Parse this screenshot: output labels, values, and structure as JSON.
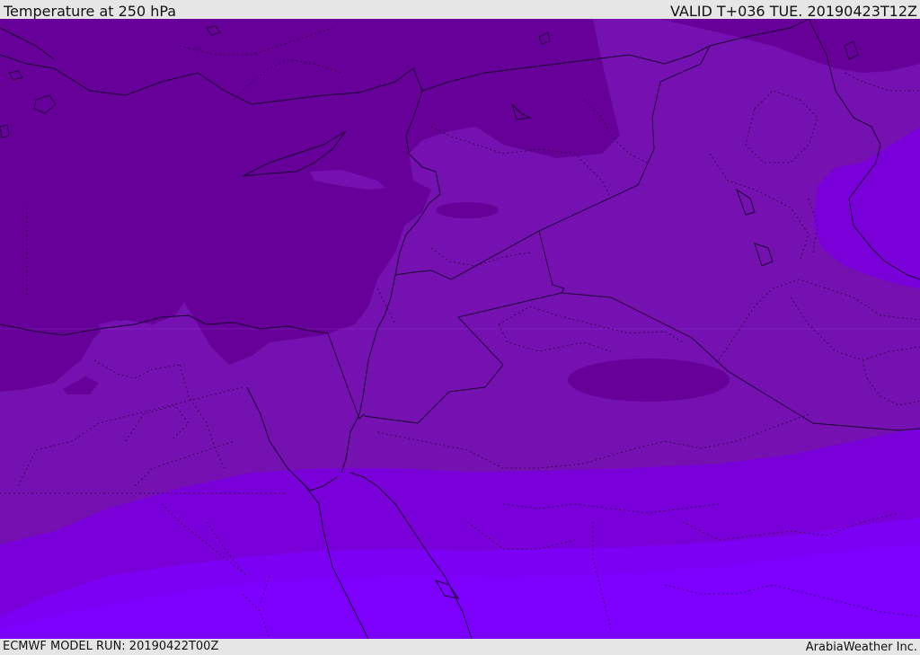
{
  "header": {
    "title": "Temperature at 250 hPa",
    "valid_time": "VALID T+036 TUE. 20190423T12Z"
  },
  "footer": {
    "model_run": "ECMWF MODEL RUN: 20190422T00Z",
    "provider": "ArabiaWeather Inc."
  },
  "colors": {
    "band_coldest": "#660099",
    "band_cold": "#7511b1",
    "band_mid": "#7a00d9",
    "band_warm": "#7c00f4",
    "band_warmest": "#7d00ff",
    "borders": "#1a0030"
  }
}
